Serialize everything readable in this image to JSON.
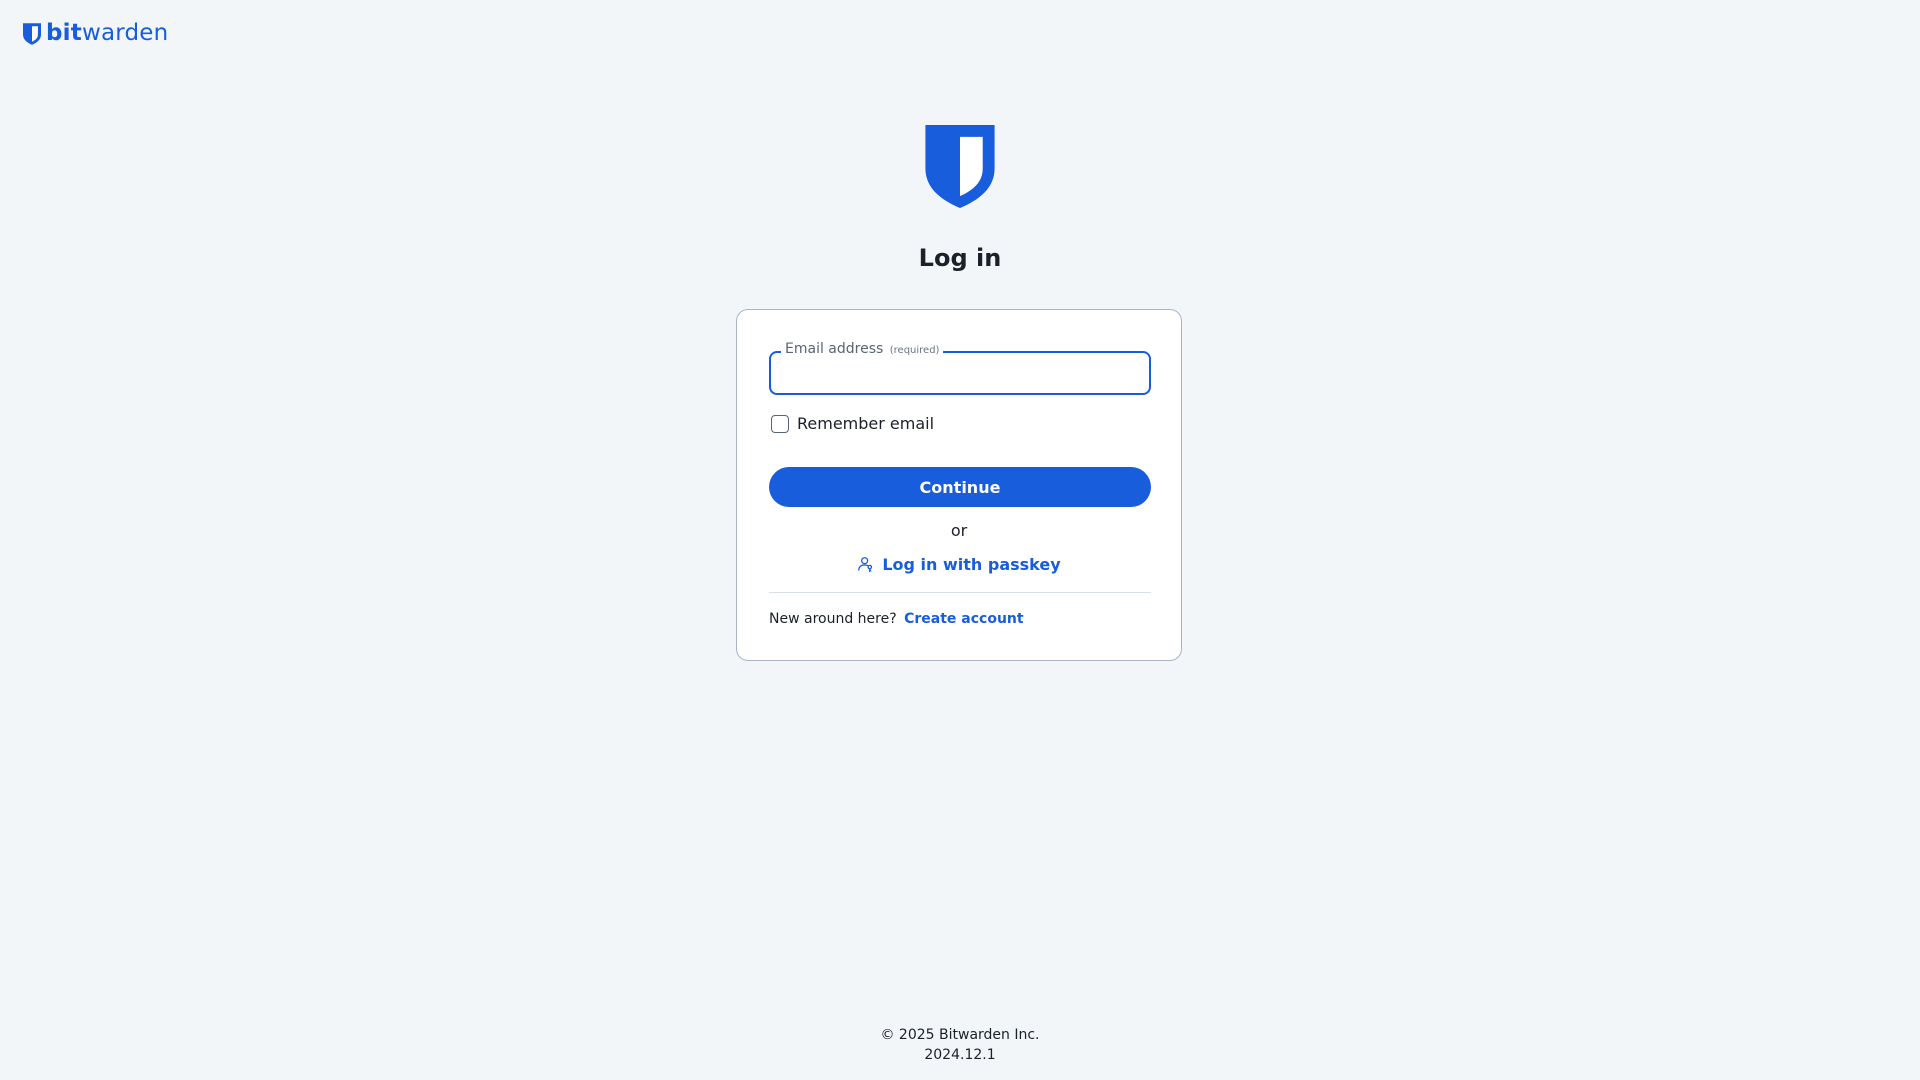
{
  "brand": {
    "name_bold": "bit",
    "name_regular": "warden",
    "logo_icon": "shield-icon",
    "color": "#175ddc"
  },
  "page": {
    "title": "Log in",
    "background": "#f3f6f9"
  },
  "form": {
    "email_label": "Email address",
    "email_required": "(required)",
    "email_value": "",
    "remember_label": "Remember email",
    "remember_checked": false,
    "continue_label": "Continue",
    "or_text": "or",
    "passkey_label": "Log in with passkey",
    "passkey_icon": "passkey-user-icon",
    "signup_prompt": "New around here?",
    "signup_link": "Create account"
  },
  "footer": {
    "copyright": "© 2025 Bitwarden Inc.",
    "version": "2024.12.1"
  }
}
